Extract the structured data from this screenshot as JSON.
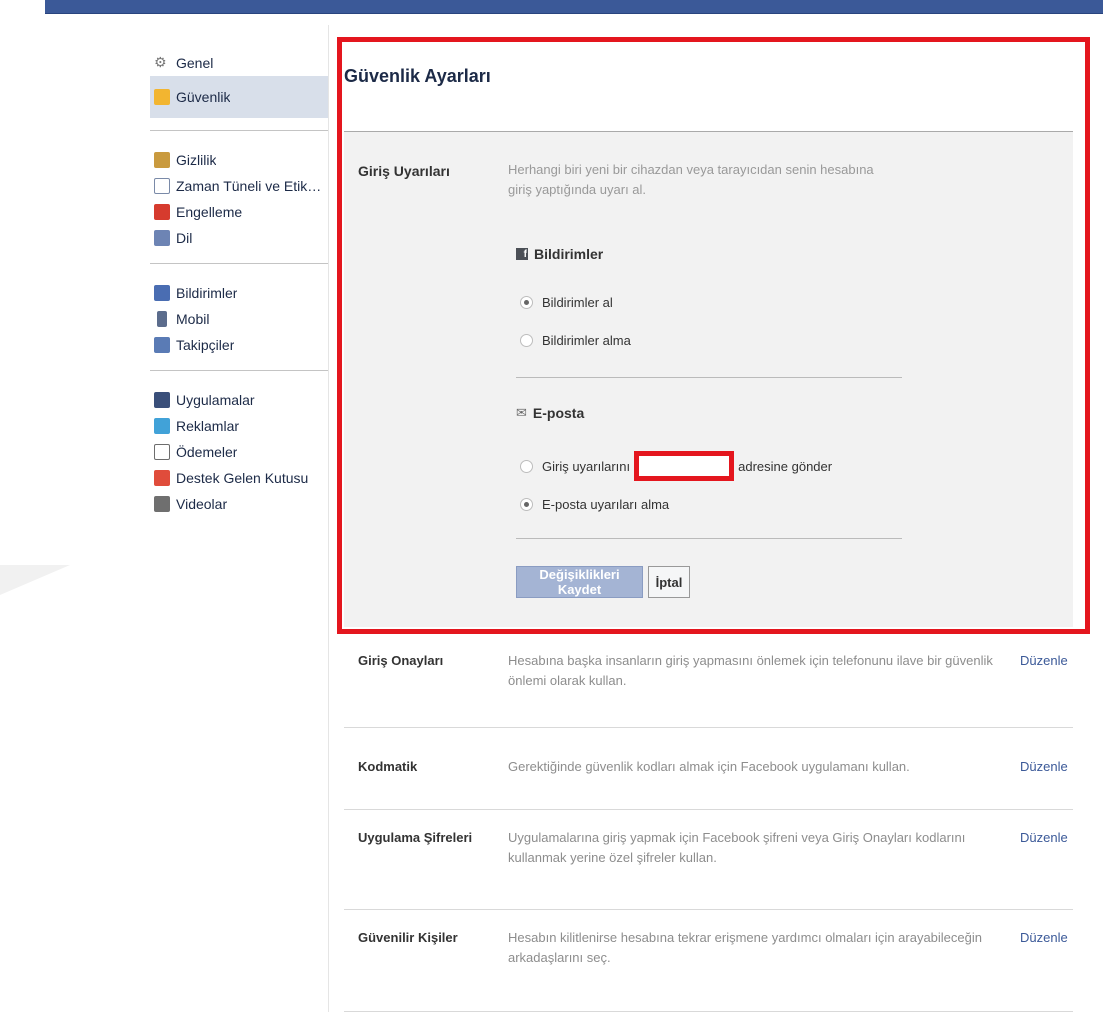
{
  "sidebar": {
    "groups": [
      {
        "items": [
          {
            "label": "Genel",
            "icon": "gear-icon"
          },
          {
            "label": "Güvenlik",
            "icon": "shield-icon",
            "active": true
          }
        ]
      },
      {
        "items": [
          {
            "label": "Gizlilik",
            "icon": "lock-icon"
          },
          {
            "label": "Zaman Tüneli ve Etiketl...",
            "icon": "timeline-icon"
          },
          {
            "label": "Engelleme",
            "icon": "block-icon"
          },
          {
            "label": "Dil",
            "icon": "globe-icon"
          }
        ]
      },
      {
        "items": [
          {
            "label": "Bildirimler",
            "icon": "notifications-icon"
          },
          {
            "label": "Mobil",
            "icon": "mobile-icon"
          },
          {
            "label": "Takipçiler",
            "icon": "rss-icon"
          }
        ]
      },
      {
        "items": [
          {
            "label": "Uygulamalar",
            "icon": "apps-icon"
          },
          {
            "label": "Reklamlar",
            "icon": "ads-icon"
          },
          {
            "label": "Ödemeler",
            "icon": "payments-icon"
          },
          {
            "label": "Destek Gelen Kutusu",
            "icon": "support-icon"
          },
          {
            "label": "Videolar",
            "icon": "video-icon"
          }
        ]
      }
    ]
  },
  "main": {
    "title": "Güvenlik Ayarları",
    "login_alerts": {
      "title": "Giriş Uyarıları",
      "description": "Herhangi biri yeni bir cihazdan veya tarayıcıdan senin hesabına giriş yaptığında uyarı al.",
      "notifications": {
        "heading": "Bildirimler",
        "options": [
          {
            "label": "Bildirimler al",
            "selected": true
          },
          {
            "label": "Bildirimler alma",
            "selected": false
          }
        ]
      },
      "email": {
        "heading": "E-posta",
        "send_prefix": "Giriş uyarılarını",
        "send_suffix": "adresine gönder",
        "send_selected": false,
        "no_alerts_label": "E-posta uyarıları alma",
        "no_alerts_selected": true
      },
      "save_label": "Değişiklikleri Kaydet",
      "cancel_label": "İptal"
    },
    "settings": [
      {
        "title": "Giriş Onayları",
        "description": "Hesabına başka insanların giriş yapmasını önlemek için telefonunu ilave bir güvenlik önlemi olarak kullan.",
        "edit": "Düzenle"
      },
      {
        "title": "Kodmatik",
        "description": "Gerektiğinde güvenlik kodları almak için Facebook uygulamanı kullan.",
        "edit": "Düzenle"
      },
      {
        "title": "Uygulama Şifreleri",
        "description": "Uygulamalarına giriş yapmak için Facebook şifreni veya Giriş Onayları kodlarını kullanmak yerine özel şifreler kullan.",
        "edit": "Düzenle"
      },
      {
        "title": "Güvenilir Kişiler",
        "description": "Hesabın kilitlenirse hesabına tekrar erişmene yardımcı olmaları için arayabileceğin arkadaşlarını seç.",
        "edit": "Düzenle"
      }
    ]
  },
  "colors": {
    "brand": "#3b5998",
    "highlight": "#e4161e",
    "active_nav": "#d8dfea"
  }
}
